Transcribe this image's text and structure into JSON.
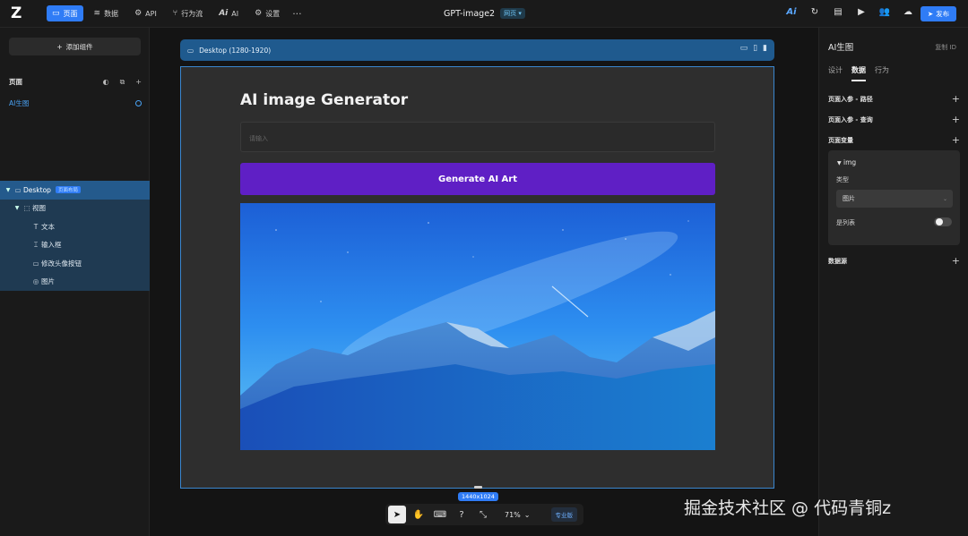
{
  "topbar": {
    "nav": [
      {
        "label": "页面",
        "icon": "page-icon",
        "active": true
      },
      {
        "label": "数据",
        "icon": "database-icon",
        "active": false
      },
      {
        "label": "API",
        "icon": "api-icon",
        "active": false
      },
      {
        "label": "行为流",
        "icon": "flow-icon",
        "active": false
      },
      {
        "label": "AI",
        "icon": "ai-icon",
        "active": false
      },
      {
        "label": "设置",
        "icon": "gear-icon",
        "active": false
      }
    ],
    "more": "···",
    "app_name": "GPT-image2",
    "app_type": "网页 ▾",
    "publish_label": "发布",
    "accent": "#2f7cf6"
  },
  "left": {
    "add_component": "添加组件",
    "pages_heading": "页面",
    "page_item": "AI生图",
    "tree": [
      {
        "label": "Desktop",
        "tag": "页面布局",
        "level": 0,
        "icon": "desktop-icon"
      },
      {
        "label": "视图",
        "level": 1,
        "icon": "view-icon"
      },
      {
        "label": "文本",
        "level": 2,
        "icon": "text-icon"
      },
      {
        "label": "输入框",
        "level": 2,
        "icon": "input-icon"
      },
      {
        "label": "修改头像按钮",
        "level": 2,
        "icon": "button-icon"
      },
      {
        "label": "图片",
        "level": 2,
        "icon": "image-icon"
      }
    ]
  },
  "canvas": {
    "frame_label": "Desktop (1280-1920)",
    "title": "AI image Generator",
    "input_placeholder": "请输入",
    "button_label": "Generate AI Art",
    "button_color": "#5f1fc5",
    "size_label": "1440x1024",
    "zoom": "71%",
    "pro_label": "专业版"
  },
  "right": {
    "title": "AI生图",
    "copy_id": "复制 ID",
    "tabs": [
      "设计",
      "数据",
      "行为"
    ],
    "active_tab": "数据",
    "sections": {
      "route_params": "页面入参 - 路径",
      "query_params": "页面入参 - 查询",
      "page_vars": "页面变量",
      "data_source": "数据源"
    },
    "variable": {
      "name": "img",
      "type_label": "类型",
      "type_value": "图片",
      "is_list_label": "是列表",
      "is_list": false
    }
  },
  "watermark": "掘金技术社区 @ 代码青铜z"
}
